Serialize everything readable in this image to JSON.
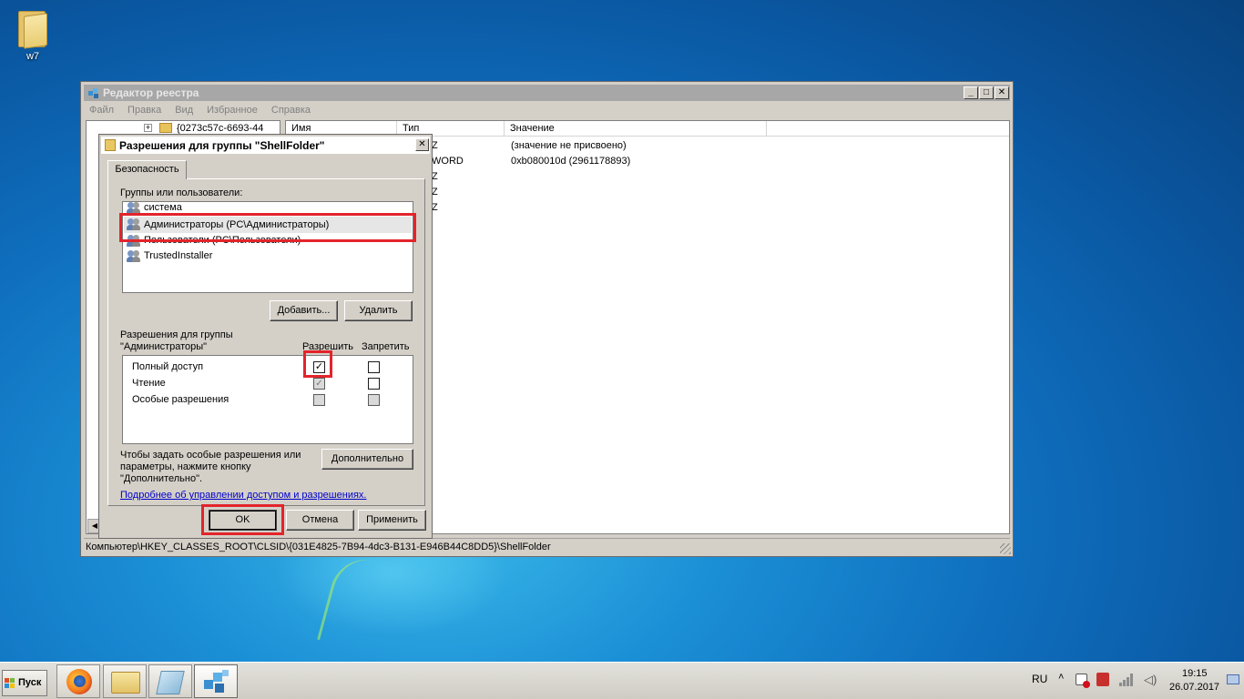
{
  "desktop": {
    "icon_label": "w7"
  },
  "regedit": {
    "title": "Редактор реестра",
    "menu": [
      "Файл",
      "Правка",
      "Вид",
      "Избранное",
      "Справка"
    ],
    "tree_item": "{0273c57c-6693-44",
    "columns": [
      "Имя",
      "Тип",
      "Значение"
    ],
    "rows": [
      {
        "type_partial": "Z",
        "value": "(значение не присвоено)"
      },
      {
        "type_partial": "WORD",
        "value": "0xb080010d (2961178893)"
      },
      {
        "type_partial": "Z",
        "value": ""
      },
      {
        "type_partial": "Z",
        "value": ""
      },
      {
        "type_partial": "Z",
        "value": ""
      }
    ],
    "status_path": "Компьютер\\HKEY_CLASSES_ROOT\\CLSID\\{031E4825-7B94-4dc3-B131-E946B44C8DD5}\\ShellFolder"
  },
  "dialog": {
    "title": "Разрешения для группы \"ShellFolder\"",
    "tab": "Безопасность",
    "groups_label": "Группы или пользователи:",
    "users": [
      "система",
      "Администраторы (PC\\Администраторы)",
      "Пользователи (PC\\Пользователи)",
      "TrustedInstaller"
    ],
    "add_button": "Добавить...",
    "remove_button": "Удалить",
    "perm_label_line1": "Разрешения для группы",
    "perm_label_line2": "\"Администраторы\"",
    "allow_header": "Разрешить",
    "deny_header": "Запретить",
    "permissions": [
      {
        "name": "Полный доступ",
        "allow": true,
        "deny": false
      },
      {
        "name": "Чтение",
        "allow": true,
        "deny": false
      },
      {
        "name": "Особые разрешения",
        "allow": false,
        "deny": false
      }
    ],
    "advanced_text_line1": "Чтобы задать особые разрешения или",
    "advanced_text_line2": "параметры, нажмите кнопку",
    "advanced_text_line3": "\"Дополнительно\".",
    "advanced_button": "Дополнительно",
    "learn_more_link": "Подробнее об управлении доступом и разрешениях.",
    "ok_button": "OK",
    "cancel_button": "Отмена",
    "apply_button": "Применить"
  },
  "taskbar": {
    "start_label": "Пуск",
    "language": "RU",
    "time": "19:15",
    "date": "26.07.2017"
  },
  "colors": {
    "highlight_red": "#e3242b",
    "link": "#0000cc"
  }
}
